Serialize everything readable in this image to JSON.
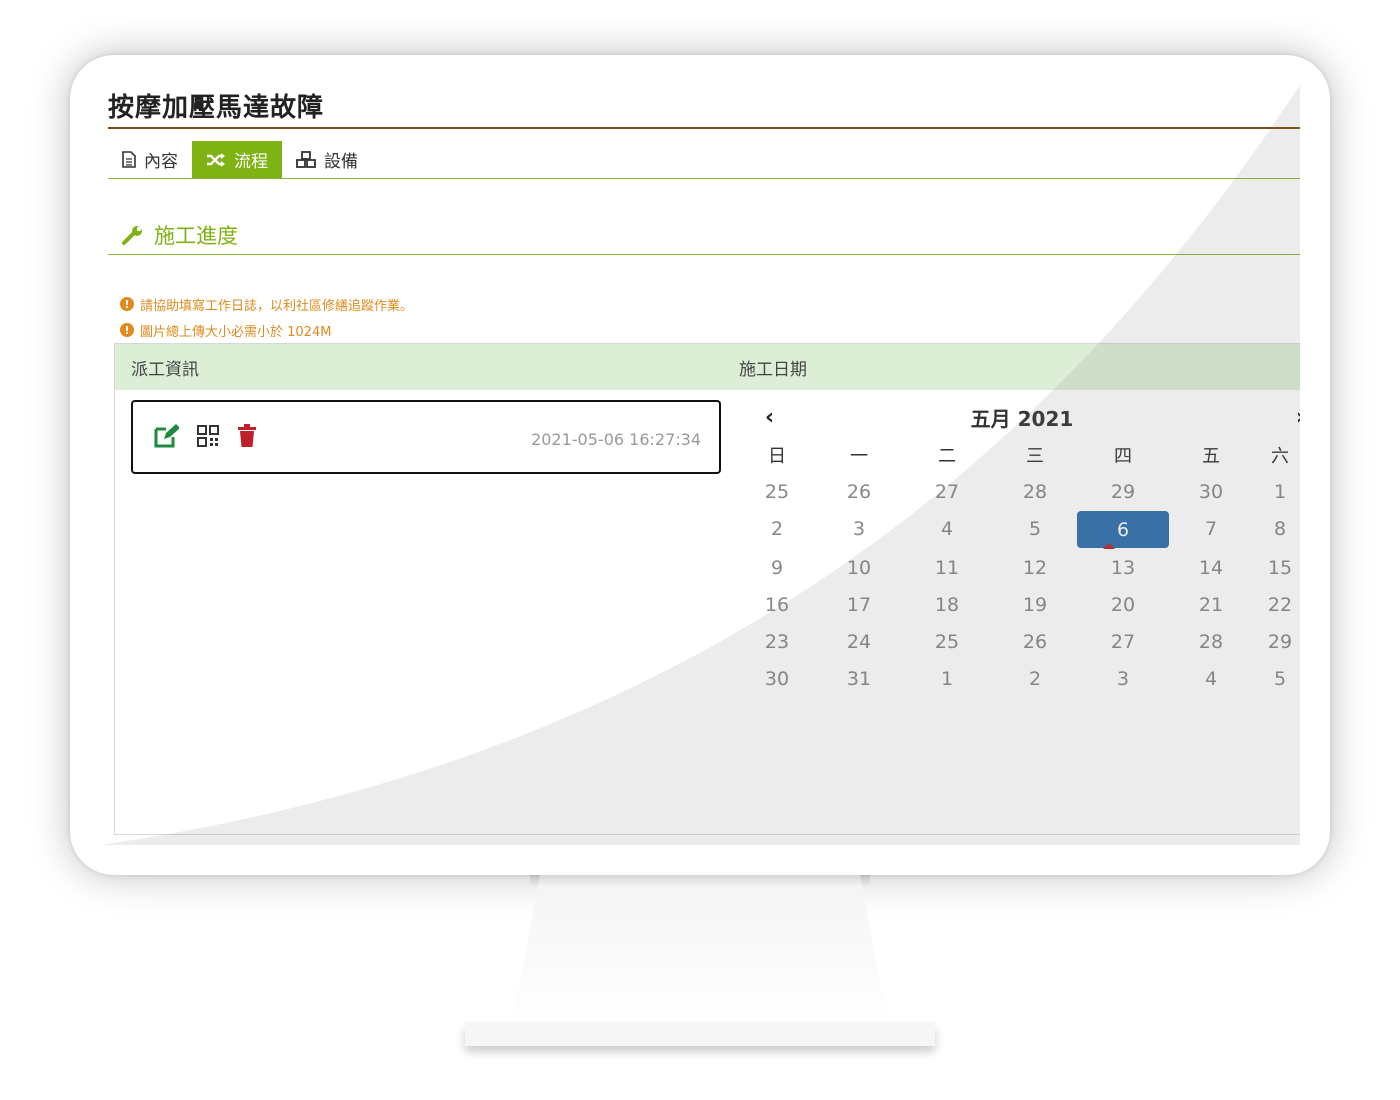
{
  "page": {
    "title": "按摩加壓馬達故障"
  },
  "tabs": [
    {
      "label": "內容",
      "icon": "file-icon",
      "active": false
    },
    {
      "label": "流程",
      "icon": "random-icon",
      "active": true
    },
    {
      "label": "設備",
      "icon": "cubes-icon",
      "active": false
    }
  ],
  "section": {
    "title": "施工進度",
    "icon": "wrench-icon"
  },
  "notes": [
    "請協助填寫工作日誌，以利社區修繕追蹤作業。",
    "圖片總上傳大小必需小於 1024M"
  ],
  "panel": {
    "col_dispatch": "派工資訊",
    "col_date": "施工日期"
  },
  "card": {
    "timestamp": "2021-05-06 16:27:34"
  },
  "calendar": {
    "title": "五月 2021",
    "prev": "‹",
    "next": "›",
    "weekdays": [
      "日",
      "一",
      "二",
      "三",
      "四",
      "五",
      "六"
    ],
    "weeks": [
      [
        "25",
        "26",
        "27",
        "28",
        "29",
        "30",
        "1"
      ],
      [
        "2",
        "3",
        "4",
        "5",
        "6",
        "7",
        "8"
      ],
      [
        "9",
        "10",
        "11",
        "12",
        "13",
        "14",
        "15"
      ],
      [
        "16",
        "17",
        "18",
        "19",
        "20",
        "21",
        "22"
      ],
      [
        "23",
        "24",
        "25",
        "26",
        "27",
        "28",
        "29"
      ],
      [
        "30",
        "31",
        "1",
        "2",
        "3",
        "4",
        "5"
      ]
    ],
    "selected_day": "6"
  },
  "colors": {
    "accent_green": "#7fb314",
    "title_rule": "#7a4e12",
    "note_orange": "#e08a1e",
    "selected_blue": "#2f6fae"
  }
}
